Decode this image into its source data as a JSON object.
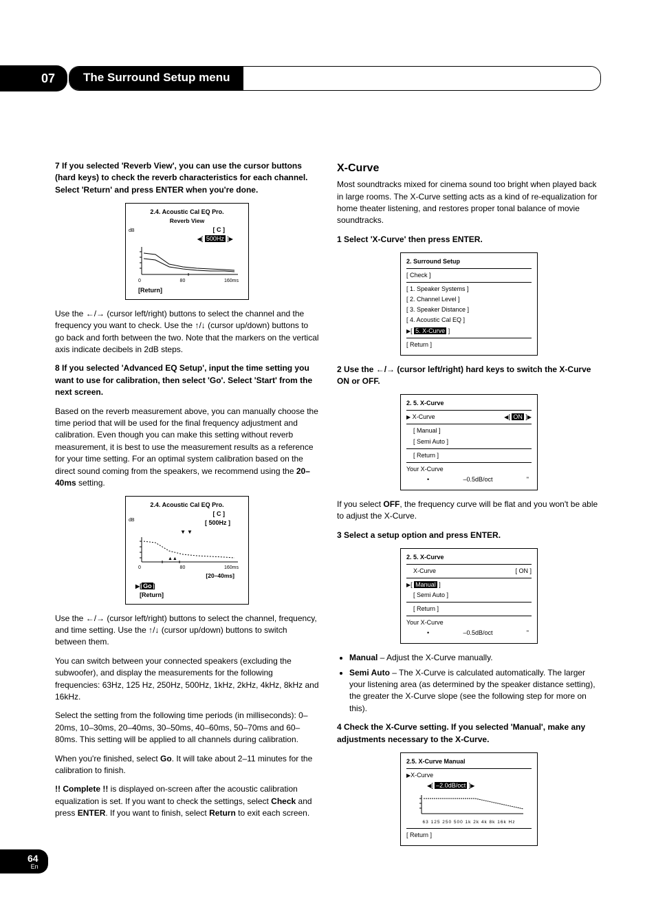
{
  "chapter": {
    "number": "07",
    "title": "The Surround Setup menu"
  },
  "left": {
    "step7": "7   If you selected 'Reverb View', you can use the cursor buttons (hard keys) to check the reverb characteristics for each channel. Select 'Return' and press ENTER when you're done.",
    "screen1": {
      "title": "2.4. Acoustic  Cal  EQ  Pro.",
      "sub": "Reverb View",
      "channel": "[  C  ]",
      "freq_hl": "500Hz",
      "y_label": "dB",
      "x_ticks": [
        "0",
        "80",
        "160ms"
      ],
      "return": "[Return]"
    },
    "p1a": "Use the ",
    "p1b": " (cursor left/right) buttons to select the channel and the frequency you want to check. Use the ",
    "p1c": " (cursor up/down) buttons to go back and forth between the two. Note that the markers on the vertical axis indicate decibels in 2dB steps.",
    "step8": "8   If you selected 'Advanced EQ Setup', input the time setting you want to use for calibration, then select 'Go'. Select 'Start' from the next screen.",
    "p2a": "Based on the reverb measurement above, you can manually choose the time period that will be used for the final frequency adjustment and calibration. Even though you can make this setting without reverb measurement, it is best to use the measurement results as a reference for your time setting. For an optimal system calibration based on the direct sound coming from the speakers, we recommend using the ",
    "p2b": "20–40ms",
    "p2c": " setting.",
    "screen2": {
      "title": "2.4. Acoustic  Cal  EQ  Pro.",
      "channel": "[  C  ]",
      "freq": "[ 500Hz ]",
      "y_label": "dB",
      "x_ticks": [
        "0",
        "80",
        "160ms"
      ],
      "time_range": "[20–40ms]",
      "go_hl": "Go",
      "return": "[Return]"
    },
    "p3a": "Use the ",
    "p3b": " (cursor left/right) buttons to select the channel, frequency, and time setting. Use the ",
    "p3c": " (cursor up/down) buttons to switch between them.",
    "p4": "You can switch between your connected speakers (excluding the subwoofer), and display the measurements for the following frequencies: 63Hz, 125 Hz, 250Hz, 500Hz, 1kHz, 2kHz, 4kHz, 8kHz and 16kHz.",
    "p5": "Select the setting from the following time periods (in milliseconds): 0–20ms, 10–30ms, 20–40ms, 30–50ms, 40–60ms, 50–70ms and 60–80ms. This setting will be applied to all channels during calibration.",
    "p6a": "When you're finished, select ",
    "p6b": "Go",
    "p6c": ". It will take about 2–11 minutes for the calibration to finish.",
    "p7a": "!! Complete !!",
    "p7b": " is displayed on-screen after the acoustic calibration equalization is set. If you want to check the settings, select ",
    "p7c": "Check",
    "p7d": " and press ",
    "p7e": "ENTER",
    "p7f": ". If you want to finish, select ",
    "p7g": "Return",
    "p7h": " to exit each screen."
  },
  "right": {
    "h2": "X-Curve",
    "intro": "Most soundtracks mixed for cinema sound too bright when played back in large rooms. The X-Curve setting acts as a kind of re-equalization for home theater listening, and restores proper tonal balance of movie soundtracks.",
    "step1": "1   Select 'X-Curve' then press ENTER.",
    "screenA": {
      "title": "2. Surround Setup",
      "check": "[ Check ]",
      "items": [
        "[ 1. Speaker Systems ]",
        "[ 2. Channel Level ]",
        "[ 3. Speaker Distance ]",
        "[ 4. Acoustic Cal EQ ]"
      ],
      "item5pre": "[ ",
      "item5hl": "5. X-Curve",
      "item5post": " ]",
      "return": "[ Return ]"
    },
    "step2a": "2   Use the ",
    "step2b": " (cursor left/right) hard keys to switch the X-Curve ON or OFF.",
    "screenB": {
      "title": "2. 5. X-Curve",
      "rowlabel": "X-Curve",
      "on_hl": "ON",
      "manual": "[ Manual ]",
      "semi": "[ Semi Auto ]",
      "return": "[ Return ]",
      "yourx": "Your X-Curve",
      "val": "–0.5dB/oct"
    },
    "p_off_a": "If you select ",
    "p_off_b": "OFF",
    "p_off_c": ", the frequency curve will be flat and you won't be able to adjust the X-Curve.",
    "step3": "3   Select a setup option and press ENTER.",
    "screenC": {
      "title": "2. 5. X-Curve",
      "rowlabel": "X-Curve",
      "on": "[ ON ]",
      "manual_hl": "Manual",
      "semi": "[ Semi Auto ]",
      "return": "[ Return ]",
      "yourx": "Your X-Curve",
      "val": "–0.5dB/oct"
    },
    "bullet1a": "Manual",
    "bullet1b": " – Adjust the X-Curve manually.",
    "bullet2a": "Semi Auto",
    "bullet2b": " – The X-Curve is calculated automatically. The larger your listening area (as determined by the speaker distance setting), the greater the X-Curve slope (see the following step for more on this).",
    "step4": "4   Check the X-Curve setting. If you selected 'Manual', make any adjustments necessary to the X-Curve.",
    "screenD": {
      "title": "2.5. X-Curve  Manual",
      "rowlabel": "X-Curve",
      "val_hl": "–2.0dB/oct",
      "return": "[ Return ]",
      "xticks": "63 125 250 500 1k 2k 4k 8k 16k Hz"
    }
  },
  "footer": {
    "page": "64",
    "lang": "En"
  }
}
